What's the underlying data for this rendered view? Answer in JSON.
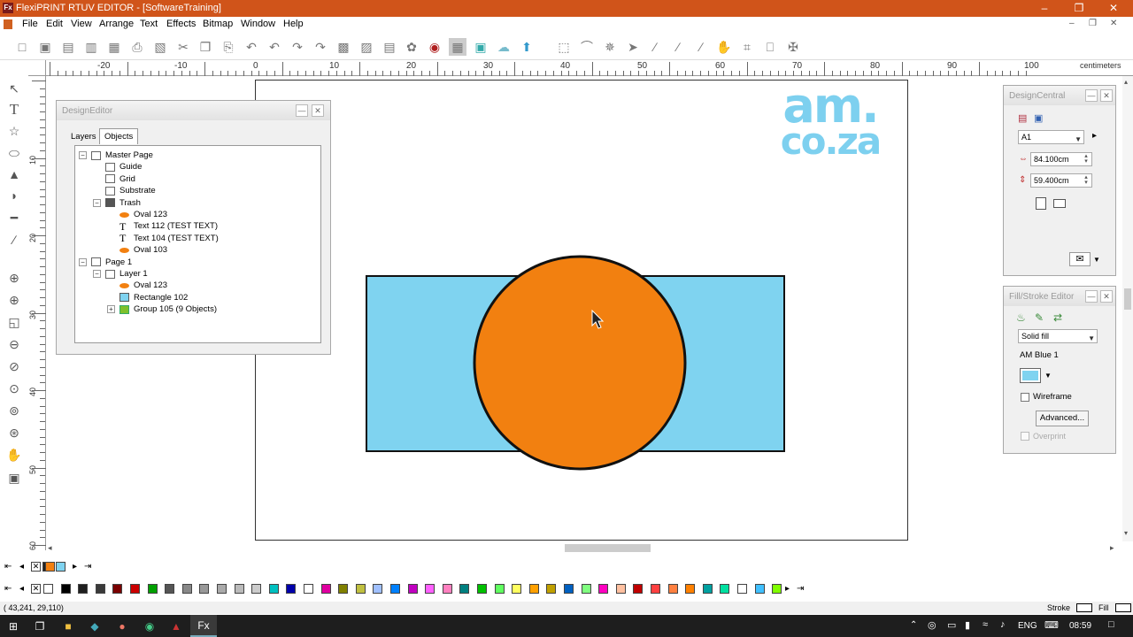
{
  "window": {
    "title": "FlexiPRINT RTUV EDITOR - [SoftwareTraining]",
    "app_icon": "Fx"
  },
  "menu": [
    "File",
    "Edit",
    "View",
    "Arrange",
    "Text",
    "Effects",
    "Bitmap",
    "Window",
    "Help"
  ],
  "ruler": {
    "unit": "centimeters",
    "top_labels": [
      "-20",
      "-10",
      "0",
      "10",
      "20",
      "30",
      "40",
      "50",
      "60",
      "70",
      "80",
      "90",
      "100"
    ],
    "left_labels": [
      "0",
      "10",
      "20",
      "30",
      "40",
      "50",
      "60"
    ]
  },
  "design_editor": {
    "title": "DesignEditor",
    "tabs": [
      "Layers",
      "Objects"
    ],
    "active_tab": "Objects",
    "tree": [
      {
        "label": "Master Page",
        "level": 0,
        "icon": "page",
        "expander": "−"
      },
      {
        "label": "Guide",
        "level": 1,
        "icon": "layer"
      },
      {
        "label": "Grid",
        "level": 1,
        "icon": "layer"
      },
      {
        "label": "Substrate",
        "level": 1,
        "icon": "layer"
      },
      {
        "label": "Trash",
        "level": 1,
        "icon": "trash",
        "expander": "−"
      },
      {
        "label": "Oval 123",
        "level": 2,
        "icon": "oval"
      },
      {
        "label": "Text 112 (TEST TEXT)",
        "level": 2,
        "icon": "text"
      },
      {
        "label": "Text 104 (TEST TEXT)",
        "level": 2,
        "icon": "text"
      },
      {
        "label": "Oval 103",
        "level": 2,
        "icon": "oval"
      },
      {
        "label": "Page 1",
        "level": 0,
        "icon": "page",
        "expander": "−"
      },
      {
        "label": "Layer 1",
        "level": 1,
        "icon": "layer",
        "expander": "−"
      },
      {
        "label": "Oval 123",
        "level": 2,
        "icon": "oval"
      },
      {
        "label": "Rectangle 102",
        "level": 2,
        "icon": "rect"
      },
      {
        "label": "Group 105 (9 Objects)",
        "level": 2,
        "icon": "group",
        "expander": "+"
      }
    ]
  },
  "design_central": {
    "title": "DesignCentral",
    "size_preset": "A1",
    "width": "84.100cm",
    "height": "59.400cm"
  },
  "fill_stroke": {
    "title": "Fill/Stroke Editor",
    "fill_type": "Solid fill",
    "color_name": "AM Blue 1",
    "color": "#7fd3f0",
    "wireframe_label": "Wireframe",
    "advanced_label": "Advanced...",
    "overprint_label": "Overprint"
  },
  "logo": {
    "line1": "am.",
    "line2": "co.za",
    "color": "#7dd0ef"
  },
  "shapes": {
    "rect_fill": "#7fd3f0",
    "oval_fill": "#f28010",
    "stroke": "#111111"
  },
  "palette_colors": [
    "#ffffff",
    "#000000",
    "#1f1f1f",
    "#3a3a3a",
    "#7a0000",
    "#cc0000",
    "#00a000",
    "#555555",
    "#888888",
    "#999999",
    "#aaaaaa",
    "#bbbbbb",
    "#cccccc",
    "#00c0c0",
    "#0000aa",
    "#ffffff",
    "#e000a0",
    "#808000",
    "#c0c040",
    "#a0c0ff",
    "#0080ff",
    "#c000c0",
    "#ff60ff",
    "#ff80c0",
    "#008080",
    "#00c000",
    "#60ff60",
    "#ffff60",
    "#ffa000",
    "#c0a000",
    "#0060c0",
    "#80ff80",
    "#ff00c0",
    "#ffc0a0",
    "#c00000",
    "#ff4040",
    "#ff8040",
    "#ff8000",
    "#00a0a0",
    "#00e0a0",
    "#ffffff",
    "#40c0ff",
    "#80ff00"
  ],
  "status": {
    "coords": "( 43,241,   29,110)",
    "stroke_label": "Stroke",
    "fill_label": "Fill"
  },
  "taskbar": {
    "lang": "ENG",
    "time": "08:59"
  }
}
